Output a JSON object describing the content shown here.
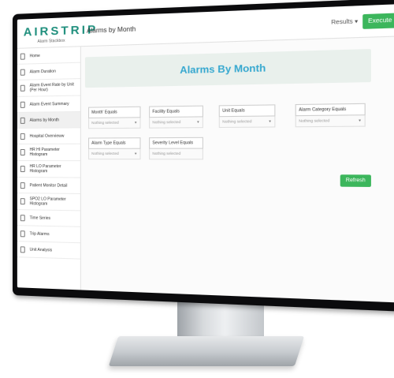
{
  "app": {
    "logo_text": "AIRSTRIP",
    "logo_sub": "Alarm Stackbox",
    "page_title": "Alarms by Month"
  },
  "toolbar": {
    "results_label": "Results ▾",
    "execute_label": "Execute"
  },
  "sidebar": {
    "items": [
      {
        "label": "Home"
      },
      {
        "label": "Alarm Duration"
      },
      {
        "label": "Alarm Event Rate by Unit (Per Hour)"
      },
      {
        "label": "Alarm Event Summary"
      },
      {
        "label": "Alarms by Month"
      },
      {
        "label": "Hospital Overvieww"
      },
      {
        "label": "HR HI Parameter Histogram"
      },
      {
        "label": "HR LO Parameter Histogram"
      },
      {
        "label": "Patient Monitor Detail"
      },
      {
        "label": "SPO2 LO Parameter Histogram"
      },
      {
        "label": "Time Series"
      },
      {
        "label": "Trip Alarms"
      },
      {
        "label": "Unit Analysis"
      }
    ]
  },
  "main": {
    "banner_title": "Alarms By Month",
    "filters": [
      {
        "label": "Month' Equals",
        "value": "Nothing selected"
      },
      {
        "label": "Facility Equals",
        "value": "Nothing selected"
      },
      {
        "label": "Unit Equals",
        "value": "Nothing selected"
      },
      {
        "label": "Alarm Category Equals",
        "value": "Nothing selected"
      },
      {
        "label": "Alarm Type Equals",
        "value": "Nothing selected"
      },
      {
        "label": "Severity Level Equals",
        "value": "Nothing selected"
      }
    ],
    "refresh_label": "Refresh"
  },
  "colors": {
    "accent_green": "#3cb65c",
    "title_blue": "#34a7cf",
    "logo_teal": "#1f8f7d"
  }
}
